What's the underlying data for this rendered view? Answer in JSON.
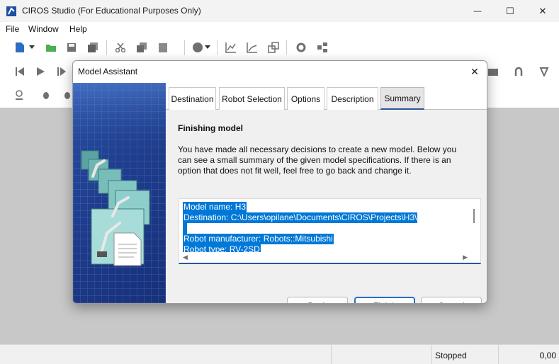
{
  "window": {
    "title": "CIROS Studio (For Educational Purposes Only)",
    "minimize_glyph": "—",
    "maximize_glyph": "☐",
    "close_glyph": "✕"
  },
  "menu": {
    "items": [
      "File",
      "Window",
      "Help"
    ]
  },
  "toolbar": {
    "icons": [
      "new-file-icon",
      "dropdown-arrow-icon",
      "open-folder-icon",
      "save-icon",
      "save-all-icon",
      "cut-icon",
      "copy-icon",
      "paste-icon",
      "record-icon",
      "dropdown-arrow-icon",
      "graph-icon",
      "graph2-icon",
      "windows-icon",
      "robot-settings-icon",
      "network-icon",
      "skip-back-icon",
      "play-icon",
      "step-icon",
      "camera-icon",
      "grip-icon",
      "gear-icon",
      "inspect-icon",
      "bug-icon",
      "bug2-icon"
    ]
  },
  "dialog": {
    "title": "Model Assistant",
    "close_glyph": "✕",
    "tabs": [
      "Destination",
      "Robot Selection",
      "Options",
      "Description",
      "Summary"
    ],
    "active_tab": "Summary",
    "heading": "Finishing model",
    "description": "You have made all necessary decisions to create a new model. Below you can see a small summary of the given model specifications. If there is an option that does not fit well, feel free to go back and change it.",
    "summary_lines": [
      "Model name: H3",
      "Destination: C:\\Users\\opilane\\Documents\\CIROS\\Projects\\H3\\",
      "",
      "Robot manufacturer: Robots::Mitsubishi",
      "Robot type: RV-2SD"
    ],
    "buttons": {
      "back": "Back",
      "finish": "Finish",
      "cancel": "Cancel"
    }
  },
  "status": {
    "state": "Stopped",
    "value": "0,00"
  },
  "colors": {
    "selection": "#0078d7",
    "accent": "#2b579a",
    "banner": "#1e3d8e"
  }
}
